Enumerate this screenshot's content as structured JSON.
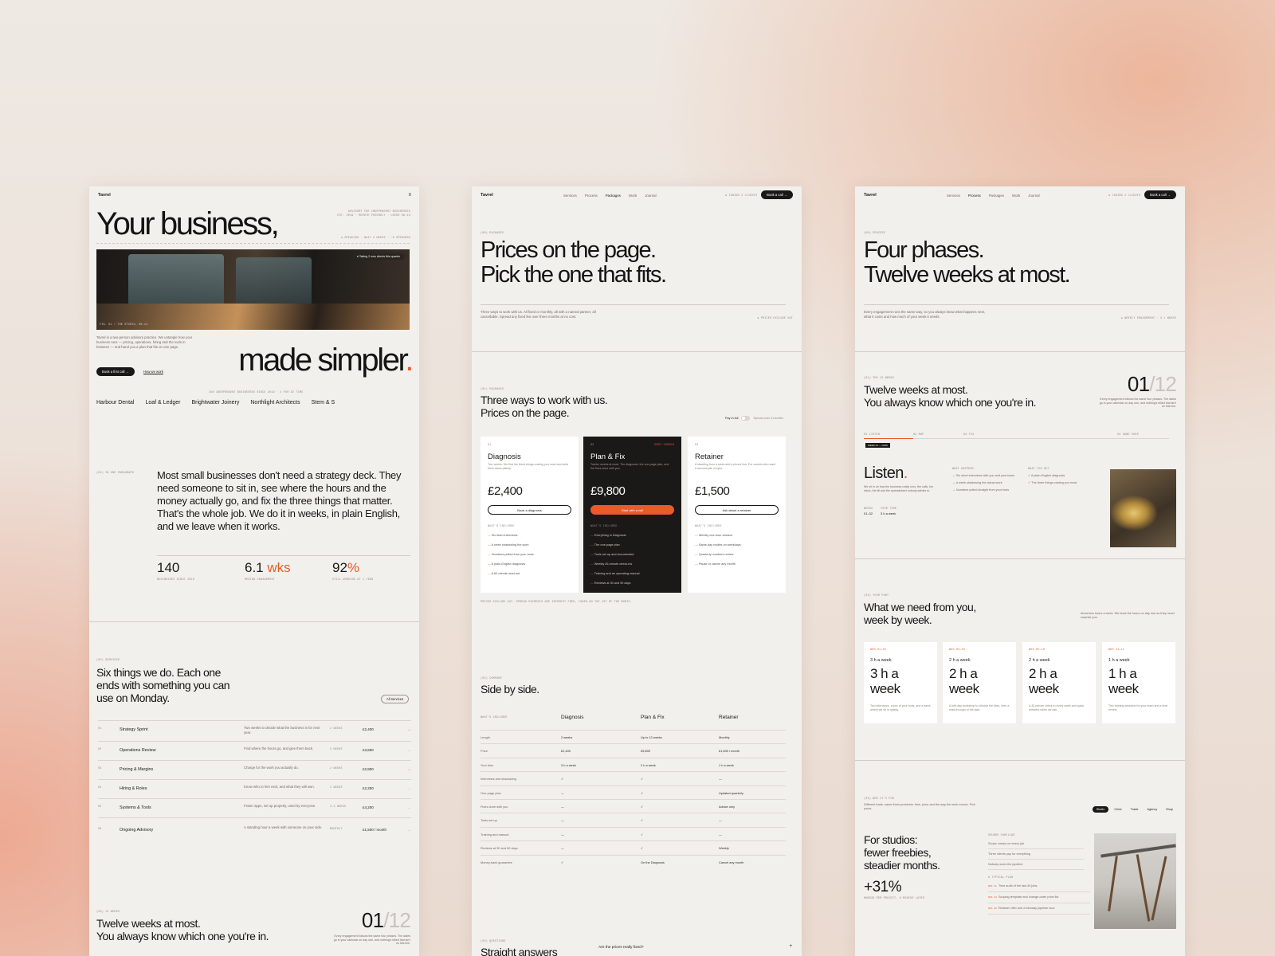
{
  "panel1": {
    "logo": "Tavrel",
    "hero_title": "Your business,",
    "hero_title_end": "made simpler",
    "hero_dot": ".",
    "photo_caption": "FIG. 01 / THE STUDIO, 08:14",
    "photo_tag": "Taking 2 new clients this quarter",
    "intro": "Tavrel is a two-person advisory practice. We untangle how your business runs — pricing, operations, hiring and the tools in between — and hand you a plan that fits on one page.",
    "cta_primary": "Book a first call →",
    "cta_secondary": "How we work",
    "clients": [
      "Harbour Dental",
      "Loaf & Ledger",
      "Brightwater Joinery",
      "Northlight Architects",
      "Stem & S"
    ],
    "statement": "Most small businesses don't need a strategy deck. They need someone to sit in, see where the hours and the money actually go, and fix the three things that matter. That's the whole job. We do it in weeks, in plain English, and we leave when it works.",
    "stats": [
      {
        "num": "140",
        "unit": ""
      },
      {
        "num": "6.1",
        "unit": " wks"
      },
      {
        "num": "92",
        "unit": "%"
      }
    ],
    "services_title": "Six things we do. Each one ends with something you can use on Monday.",
    "services_btn": "All services",
    "services": [
      {
        "no": "01",
        "name": "Strategy Sprint",
        "desc": "Two weeks to decide what the business is for next year.",
        "len": "2 WEEKS",
        "price": "£2,400"
      },
      {
        "no": "02",
        "name": "Operations Review",
        "desc": "Find where the hours go, and give them back.",
        "len": "3 WEEKS",
        "price": "£3,600"
      },
      {
        "no": "03",
        "name": "Pricing & Margins",
        "desc": "Charge for the work you actually do.",
        "len": "2 WEEKS",
        "price": "£2,800"
      },
      {
        "no": "04",
        "name": "Hiring & Roles",
        "desc": "Know who to hire next, and what they will own.",
        "len": "2 WEEKS",
        "price": "£2,200"
      },
      {
        "no": "05",
        "name": "Systems & Tools",
        "desc": "Fewer apps, set up properly, used by everyone.",
        "len": "3-4 WEEKS",
        "price": "£4,200"
      },
      {
        "no": "06",
        "name": "Ongoing Advisory",
        "desc": "A standing hour a week with someone on your side.",
        "len": "MONTHLY",
        "price": "£1,500 / month"
      }
    ],
    "weeks_title": "Twelve weeks at most.\nYou always know which one you're in.",
    "counter_now": "01",
    "counter_total": "/12"
  },
  "panel2": {
    "logo": "Tavrel",
    "nav": [
      "Services",
      "Process",
      "Packages",
      "Work",
      "Journal"
    ],
    "book": "Book a call →",
    "hero_l1": "Prices on the page.",
    "hero_l2": "Pick the one that fits.",
    "hero_sub": "Three ways to work with us. All fixed or monthly, all with a named partner, all cancellable. Spread any fixed fee over three months at no cost.",
    "sec_title_1": "Three ways to work with us.",
    "sec_title_2": "Prices on the page.",
    "pay_toggle": "Pay in full",
    "spread": "Spread over 3 months",
    "cards": [
      {
        "name": "Diagnosis",
        "price": "£2,400",
        "desc": "Two weeks. We find the three things costing you most and write them down plainly.",
        "btn": "Book a diagnosis",
        "items": [
          "Six team interviews",
          "A week shadowing the work",
          "Numbers pulled from your tools",
          "A plain-English diagnosis",
          "A 60-minute read-out"
        ]
      },
      {
        "name": "Plan & Fix",
        "price": "£9,800",
        "desc": "Twelve weeks at most. The diagnosis, the one-page plan, and the fixes done with you.",
        "btn": "Start with a call",
        "items": [
          "Everything in Diagnosis",
          "The one-page plan",
          "Tools set up and documented",
          "Weekly 45-minute check-ins",
          "Training and an operating manual",
          "Reviews at 30 and 90 days"
        ]
      },
      {
        "name": "Retainer",
        "price": "£1,500",
        "desc": "A standing hour a week and a phone line. For owners who want a second pair of eyes.",
        "btn": "Ask about a retainer",
        "items": [
          "Weekly one-hour session",
          "Same-day replies on weekdays",
          "Quarterly numbers review",
          "Pause or cancel any month"
        ]
      }
    ],
    "compare_title": "Side by side.",
    "compare_cols": [
      "Diagnosis",
      "Plan & Fix",
      "Retainer"
    ],
    "compare_rows": [
      {
        "k": "Length",
        "v": [
          "2 weeks",
          "Up to 12 weeks",
          "Monthly"
        ]
      },
      {
        "k": "Price",
        "v": [
          "£2,400",
          "£9,800",
          "£1,500 / month"
        ]
      },
      {
        "k": "Your time",
        "v": [
          "3 h a week",
          "2 h a week",
          "1 h a week"
        ]
      },
      {
        "k": "Interviews and shadowing",
        "v": [
          "✓",
          "✓",
          "—"
        ]
      },
      {
        "k": "One-page plan",
        "v": [
          "—",
          "✓",
          "Updated quarterly"
        ]
      },
      {
        "k": "Fixes done with you",
        "v": [
          "—",
          "✓",
          "Advice only"
        ]
      },
      {
        "k": "Tools set up",
        "v": [
          "—",
          "✓",
          "—"
        ]
      },
      {
        "k": "Training and manual",
        "v": [
          "—",
          "✓",
          "—"
        ]
      },
      {
        "k": "Reviews at 30 and 90 days",
        "v": [
          "—",
          "✓",
          "Weekly"
        ]
      },
      {
        "k": "Money-back guarantee",
        "v": [
          "✓",
          "On the Diagnosis",
          "Cancel any month"
        ]
      }
    ],
    "faq_title": "Straight answers",
    "faq_q": "Are the prices really fixed?"
  },
  "panel3": {
    "logo": "Tavrel",
    "nav": [
      "Services",
      "Process",
      "Packages",
      "Work",
      "Journal"
    ],
    "book": "Book a call →",
    "hero_l1": "Four phases.",
    "hero_l2": "Twelve weeks at most.",
    "hero_sub": "Every engagement runs the same way, so you always know what happens next, what it costs and how much of your week it needs.",
    "weeks_title": "Twelve weeks at most.\nYou always know which one you're in.",
    "counter_now": "01",
    "counter_total": "/12",
    "phase": "Listen",
    "phase_dot": ".",
    "phase_desc": "We sit in on how the business really runs: the calls, the inbox, the till and the spreadsheet nobody admits to.",
    "phase_weeks": "01–02",
    "phase_time": "3 h a week",
    "phase_items_a": [
      "Six short interviews with you and your team",
      "A week shadowing the actual work",
      "Numbers pulled straight from your tools"
    ],
    "phase_items_b": [
      "A plain-English diagnosis",
      "The three things costing you most"
    ],
    "need_title": "What we need from you, week by week.",
    "need_sub": "About two hours a week. We book the hours on day one so they never surprise you.",
    "weeks": [
      {
        "t": "3 h a week",
        "big": "3 h a week",
        "d": "Two interviews, a tour of your tools, and a week where we sit in quietly."
      },
      {
        "t": "2 h a week",
        "big": "2 h a week",
        "d": "A half-day workshop to choose the fixes, then a read-through of the plan."
      },
      {
        "t": "2 h a week",
        "big": "2 h a week",
        "d": "A 45-minute check-in every week and quick answers when we ask."
      },
      {
        "t": "1 h a week",
        "big": "1 h a week",
        "d": "Two training sessions for your team and a final review."
      }
    ],
    "fit_sub": "Different trade, same three problems: time, price and the way the work moves. Pick yours.",
    "tabs": [
      "Studio",
      "Clinic",
      "Trade",
      "Agency",
      "Shop"
    ],
    "studio_title": "For studios:\nfewer freebies,\nsteadier months.",
    "studio_stat": "+31%",
    "studio_list": [
      "Scope creeps on every job",
      "Three clients pay for everything",
      "Nobody owns the pipeline"
    ],
    "studio_steps": [
      "Time audit of the last 40 jobs",
      "Scoping template and change-order price list",
      "Retainer offer and a Monday pipeline hour"
    ]
  }
}
